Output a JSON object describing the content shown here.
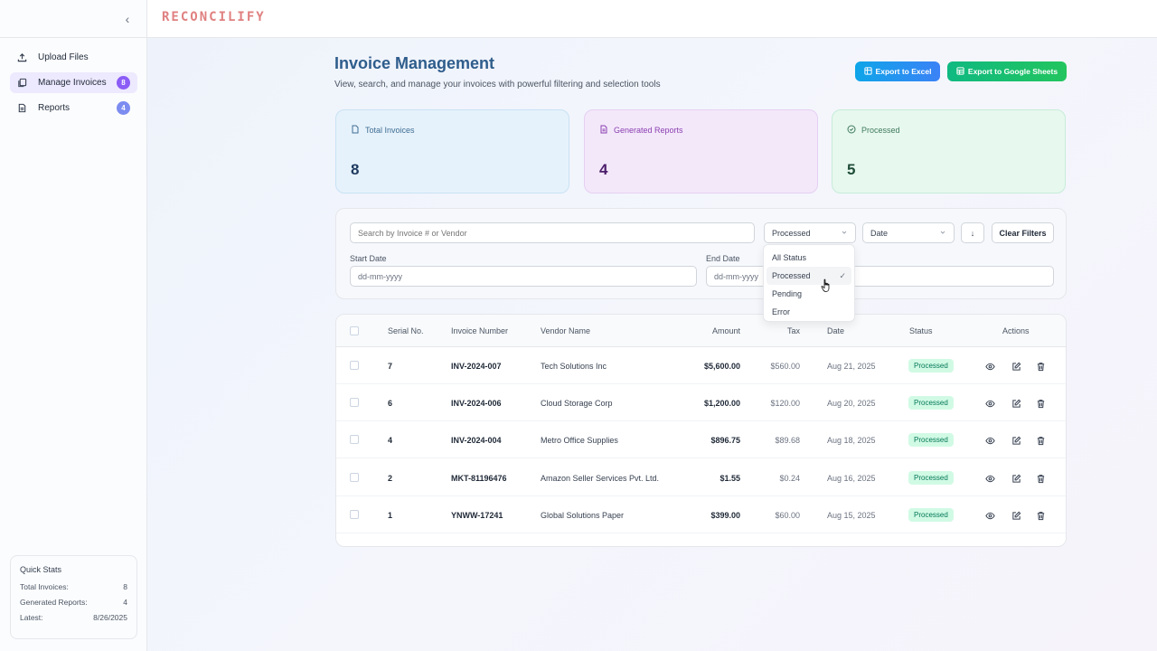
{
  "app": {
    "logo": "RECONCILIFY"
  },
  "sidebar": {
    "items": [
      {
        "label": "Upload Files",
        "icon": "upload-icon"
      },
      {
        "label": "Manage Invoices",
        "icon": "copy-icon",
        "badge": "8",
        "active": true
      },
      {
        "label": "Reports",
        "icon": "file-icon",
        "badge": "4"
      }
    ],
    "quick_stats": {
      "title": "Quick Stats",
      "rows": [
        {
          "label": "Total Invoices:",
          "value": "8"
        },
        {
          "label": "Generated Reports:",
          "value": "4"
        },
        {
          "label": "Latest:",
          "value": "8/26/2025"
        }
      ]
    }
  },
  "header": {
    "title": "Invoice Management",
    "subtitle": "View, search, and manage your invoices with powerful filtering and selection tools",
    "export_excel": "Export to Excel",
    "export_sheets": "Export to Google Sheets"
  },
  "stats": [
    {
      "label": "Total Invoices",
      "value": "8",
      "icon": "document-icon"
    },
    {
      "label": "Generated Reports",
      "value": "4",
      "icon": "report-icon"
    },
    {
      "label": "Processed",
      "value": "5",
      "icon": "check-circle-icon"
    }
  ],
  "filters": {
    "search_placeholder": "Search by Invoice # or Vendor",
    "status_value": "Processed",
    "sort_field_value": "Date",
    "sort_dir": "↓",
    "clear_label": "Clear Filters",
    "start_label": "Start Date",
    "end_label": "End Date",
    "date_placeholder": "dd-mm-yyyy",
    "status_options": [
      "All Status",
      "Processed",
      "Pending",
      "Error"
    ],
    "selected_check": "✓"
  },
  "table": {
    "columns": [
      "Serial No.",
      "Invoice Number",
      "Vendor Name",
      "Amount",
      "Tax",
      "Date",
      "Status",
      "Actions"
    ],
    "rows": [
      {
        "serial": "7",
        "invoice": "INV-2024-007",
        "vendor": "Tech Solutions Inc",
        "amount": "$5,600.00",
        "tax": "$560.00",
        "date": "Aug 21, 2025",
        "status": "Processed"
      },
      {
        "serial": "6",
        "invoice": "INV-2024-006",
        "vendor": "Cloud Storage Corp",
        "amount": "$1,200.00",
        "tax": "$120.00",
        "date": "Aug 20, 2025",
        "status": "Processed"
      },
      {
        "serial": "4",
        "invoice": "INV-2024-004",
        "vendor": "Metro Office Supplies",
        "amount": "$896.75",
        "tax": "$89.68",
        "date": "Aug 18, 2025",
        "status": "Processed"
      },
      {
        "serial": "2",
        "invoice": "MKT-81196476",
        "vendor": "Amazon Seller Services Pvt. Ltd.",
        "amount": "$1.55",
        "tax": "$0.24",
        "date": "Aug 16, 2025",
        "status": "Processed"
      },
      {
        "serial": "1",
        "invoice": "YNWW-17241",
        "vendor": "Global Solutions Paper",
        "amount": "$399.00",
        "tax": "$60.00",
        "date": "Aug 15, 2025",
        "status": "Processed"
      }
    ]
  },
  "colors": {
    "accent": "#8b5cf6",
    "excel": "#0ea5e9",
    "sheets": "#10b981",
    "processed_bg": "#d1fae5",
    "processed_text": "#047857"
  }
}
